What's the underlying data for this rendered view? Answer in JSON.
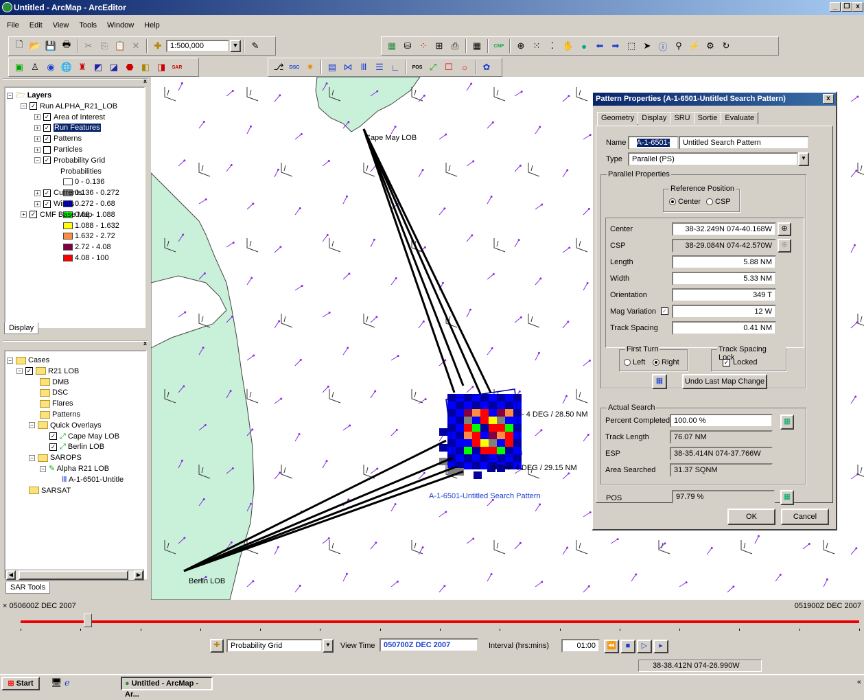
{
  "window": {
    "title": "Untitled - ArcMap - ArcEditor",
    "min": "_",
    "max": "❐",
    "close": "x"
  },
  "menu": [
    "File",
    "Edit",
    "View",
    "Tools",
    "Window",
    "Help"
  ],
  "toolbar": {
    "scale": "1:500,000",
    "sar_label": "SAR",
    "cmf_label": "CMF",
    "dsc_label": "DSC",
    "pos_label": "POS"
  },
  "toc": {
    "title": "Layers",
    "run_layer": "Run ALPHA_R21_LOB",
    "items": [
      "Area of Interest",
      "Run Features",
      "Patterns",
      "Particles",
      "Probability Grid"
    ],
    "legend_title": "Probabilities",
    "legend": [
      {
        "label": "0 - 0.136",
        "color": "#ffffff"
      },
      {
        "label": "0.136 - 0.272",
        "color": "#808080"
      },
      {
        "label": "0.272 - 0.68",
        "color": "#0000ff"
      },
      {
        "label": "0.68 - 1.088",
        "color": "#00ff00"
      },
      {
        "label": "1.088 - 1.632",
        "color": "#ffff00"
      },
      {
        "label": "1.632 - 2.72",
        "color": "#ff8c40"
      },
      {
        "label": "2.72 - 4.08",
        "color": "#800040"
      },
      {
        "label": "4.08 - 100",
        "color": "#ff0000"
      }
    ],
    "more": [
      "Currents",
      "Winds"
    ],
    "base": "CMF Base Map",
    "tab": "Display"
  },
  "cases": {
    "root": "Cases",
    "case": "R21 LOB",
    "folders": [
      "DMB",
      "DSC",
      "Flares",
      "Patterns"
    ],
    "quick": "Quick Overlays",
    "overlays": [
      "Cape May LOB",
      "Berlin LOB"
    ],
    "sarops": "SAROPS",
    "alpha": "Alpha R21 LOB",
    "pattern": "A-1-6501-Untitle",
    "sarsat": "SARSAT",
    "tab": "SAR Tools"
  },
  "map": {
    "cape_may": "Cape May LOB",
    "berlin": "Berlin LOB",
    "lob1": "- 4 DEG / 28.50 NM",
    "lob2": "0 T +/- 4 DEG / 29.15 NM",
    "pattern_label": "A-1-6501-Untitled Search Pattern"
  },
  "dialog": {
    "title": "Pattern Properties (A-1-6501-Untitled Search Pattern)",
    "tabs": [
      "Geometry",
      "Display",
      "SRU",
      "Sortie",
      "Evaluate"
    ],
    "name_label": "Name",
    "name_id": "A-1-6501-",
    "name_value": "Untitled Search Pattern",
    "type_label": "Type",
    "type_value": "Parallel (PS)",
    "parallel_group": "Parallel Properties",
    "ref_group": "Reference Position",
    "ref_center": "Center",
    "ref_csp": "CSP",
    "rows": [
      {
        "label": "Center",
        "value": "38-32.249N 074-40.168W"
      },
      {
        "label": "CSP",
        "value": "38-29.084N 074-42.570W"
      },
      {
        "label": "Length",
        "value": "5.88 NM"
      },
      {
        "label": "Width",
        "value": "5.33 NM"
      },
      {
        "label": "Orientation",
        "value": "349 T"
      },
      {
        "label": "Mag Variation",
        "value": "12 W"
      },
      {
        "label": "Track Spacing",
        "value": "0.41 NM"
      }
    ],
    "first_turn": "First Turn",
    "left": "Left",
    "right": "Right",
    "lock_group": "Track Spacing Lock",
    "locked": "Locked",
    "undo": "Undo Last Map Change",
    "actual_group": "Actual Search",
    "percent_label": "Percent Completed",
    "percent_value": "100.00 %",
    "track_label": "Track Length",
    "track_value": "76.07 NM",
    "esp_label": "ESP",
    "esp_value": "38-35.414N 074-37.766W",
    "area_label": "Area Searched",
    "area_value": "31.37 SQNM",
    "pos_label": "POS",
    "pos_value": "97.79 %",
    "ok": "OK",
    "cancel": "Cancel"
  },
  "time": {
    "start": "050600Z DEC 2007",
    "end": "051900Z DEC 2007",
    "layer": "Probability Grid",
    "view_label": "View Time",
    "view_value": "050700Z DEC 2007",
    "interval_label": "Interval (hrs:mins)",
    "interval_value": "01:00",
    "slider_fraction": 0.08
  },
  "status": {
    "coords": "38-38.412N 074-26.990W"
  },
  "taskbar": {
    "start": "Start",
    "task": "Untitled - ArcMap - Ar..."
  }
}
